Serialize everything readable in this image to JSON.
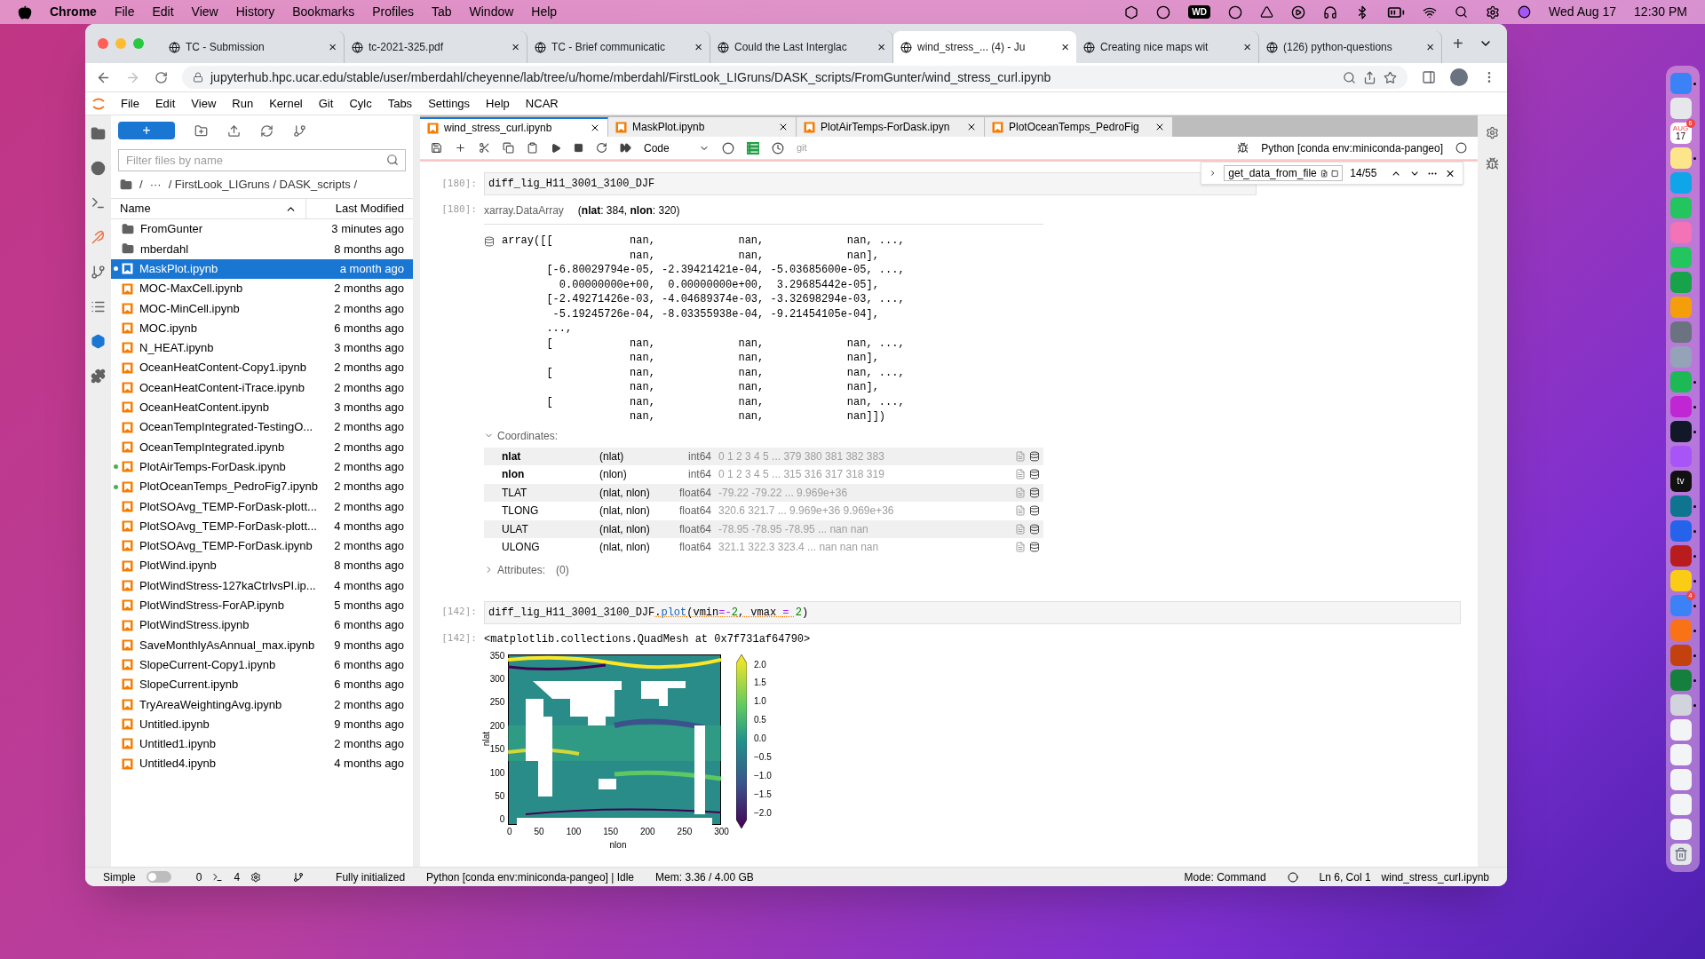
{
  "menubar": {
    "app": "Chrome",
    "items": [
      "File",
      "Edit",
      "View",
      "History",
      "Bookmarks",
      "Profiles",
      "Tab",
      "Window",
      "Help"
    ],
    "wd": "WD",
    "date": "Wed Aug 17",
    "time": "12:30 PM"
  },
  "browser": {
    "tabs": [
      {
        "title": "TC - Submission",
        "selected": false
      },
      {
        "title": "tc-2021-325.pdf",
        "selected": false
      },
      {
        "title": "TC - Brief communicatic",
        "selected": false
      },
      {
        "title": "Could the Last Interglac",
        "selected": false
      },
      {
        "title": "wind_stress_... (4) - Ju",
        "selected": true
      },
      {
        "title": "Creating nice maps wit",
        "selected": false
      },
      {
        "title": "(126) python-questions",
        "selected": false
      }
    ],
    "close": "×",
    "new_tab": "+",
    "url": "jupyterhub.hpc.ucar.edu/stable/user/mberdahl/cheyenne/lab/tree/u/home/mberdahl/FirstLook_LIGruns/DASK_scripts/FromGunter/wind_stress_curl.ipynb"
  },
  "jupyter_menu": [
    "File",
    "Edit",
    "View",
    "Run",
    "Kernel",
    "Git",
    "Cylc",
    "Tabs",
    "Settings",
    "Help",
    "NCAR"
  ],
  "file_browser": {
    "new_label": "+",
    "filter": {
      "placeholder": "Filter files by name"
    },
    "breadcrumb": [
      "/",
      "···",
      "/ FirstLook_LIGruns / DASK_scripts /"
    ],
    "columns": [
      "Name",
      "Last Modified"
    ],
    "rows": [
      {
        "name": "FromGunter",
        "modified": "3 minutes ago",
        "kind": "folder",
        "selected": false,
        "running": false
      },
      {
        "name": "mberdahl",
        "modified": "8 months ago",
        "kind": "folder",
        "selected": false,
        "running": false
      },
      {
        "name": "MaskPlot.ipynb",
        "modified": "a month ago",
        "kind": "notebook",
        "selected": true,
        "running": true
      },
      {
        "name": "MOC-MaxCell.ipynb",
        "modified": "2 months ago",
        "kind": "notebook",
        "selected": false,
        "running": false
      },
      {
        "name": "MOC-MinCell.ipynb",
        "modified": "2 months ago",
        "kind": "notebook",
        "selected": false,
        "running": false
      },
      {
        "name": "MOC.ipynb",
        "modified": "6 months ago",
        "kind": "notebook",
        "selected": false,
        "running": false
      },
      {
        "name": "N_HEAT.ipynb",
        "modified": "3 months ago",
        "kind": "notebook",
        "selected": false,
        "running": false
      },
      {
        "name": "OceanHeatContent-Copy1.ipynb",
        "modified": "2 months ago",
        "kind": "notebook",
        "selected": false,
        "running": false
      },
      {
        "name": "OceanHeatContent-iTrace.ipynb",
        "modified": "2 months ago",
        "kind": "notebook",
        "selected": false,
        "running": false
      },
      {
        "name": "OceanHeatContent.ipynb",
        "modified": "3 months ago",
        "kind": "notebook",
        "selected": false,
        "running": false
      },
      {
        "name": "OceanTempIntegrated-TestingO...",
        "modified": "2 months ago",
        "kind": "notebook",
        "selected": false,
        "running": false
      },
      {
        "name": "OceanTempIntegrated.ipynb",
        "modified": "2 months ago",
        "kind": "notebook",
        "selected": false,
        "running": false
      },
      {
        "name": "PlotAirTemps-ForDask.ipynb",
        "modified": "2 months ago",
        "kind": "notebook",
        "selected": false,
        "running": true
      },
      {
        "name": "PlotOceanTemps_PedroFig7.ipynb",
        "modified": "2 months ago",
        "kind": "notebook",
        "selected": false,
        "running": true
      },
      {
        "name": "PlotSOAvg_TEMP-ForDask-plott...",
        "modified": "2 months ago",
        "kind": "notebook",
        "selected": false,
        "running": false
      },
      {
        "name": "PlotSOAvg_TEMP-ForDask-plott...",
        "modified": "4 months ago",
        "kind": "notebook",
        "selected": false,
        "running": false
      },
      {
        "name": "PlotSOAvg_TEMP-ForDask.ipynb",
        "modified": "2 months ago",
        "kind": "notebook",
        "selected": false,
        "running": false
      },
      {
        "name": "PlotWind.ipynb",
        "modified": "8 months ago",
        "kind": "notebook",
        "selected": false,
        "running": false
      },
      {
        "name": "PlotWindStress-127kaCtrlvsPI.ip...",
        "modified": "4 months ago",
        "kind": "notebook",
        "selected": false,
        "running": false
      },
      {
        "name": "PlotWindStress-ForAP.ipynb",
        "modified": "5 months ago",
        "kind": "notebook",
        "selected": false,
        "running": false
      },
      {
        "name": "PlotWindStress.ipynb",
        "modified": "6 months ago",
        "kind": "notebook",
        "selected": false,
        "running": false
      },
      {
        "name": "SaveMonthlyAsAnnual_max.ipynb",
        "modified": "9 months ago",
        "kind": "notebook",
        "selected": false,
        "running": false
      },
      {
        "name": "SlopeCurrent-Copy1.ipynb",
        "modified": "6 months ago",
        "kind": "notebook",
        "selected": false,
        "running": false
      },
      {
        "name": "SlopeCurrent.ipynb",
        "modified": "6 months ago",
        "kind": "notebook",
        "selected": false,
        "running": false
      },
      {
        "name": "TryAreaWeightingAvg.ipynb",
        "modified": "2 months ago",
        "kind": "notebook",
        "selected": false,
        "running": false
      },
      {
        "name": "Untitled.ipynb",
        "modified": "9 months ago",
        "kind": "notebook",
        "selected": false,
        "running": false
      },
      {
        "name": "Untitled1.ipynb",
        "modified": "2 months ago",
        "kind": "notebook",
        "selected": false,
        "running": false
      },
      {
        "name": "Untitled4.ipynb",
        "modified": "4 months ago",
        "kind": "notebook",
        "selected": false,
        "running": false
      }
    ]
  },
  "notebook": {
    "tabs": [
      {
        "title": "wind_stress_curl.ipynb",
        "selected": true
      },
      {
        "title": "MaskPlot.ipynb",
        "selected": false
      },
      {
        "title": "PlotAirTemps-ForDask.ipyn",
        "selected": false
      },
      {
        "title": "PlotOceanTemps_PedroFig",
        "selected": false
      }
    ],
    "cell_type": "Code",
    "git": "git",
    "kernel": "Python [conda env:miniconda-pangeo]",
    "find": {
      "value": "get_data_from_file",
      "count": "14/55"
    },
    "cell1": {
      "in_prompt": "[180]:",
      "code": "diff_lig_H11_3001_3100_DJF",
      "out_prompt": "[180]:",
      "type": "xarray.DataArray",
      "dims": "(**nlat**: 384, **nlon**: 320)",
      "array": [
        "array([[            nan,             nan,             nan, ...,",
        "                    nan,             nan,             nan],",
        "       [-6.80029794e-05, -2.39421421e-04, -5.03685600e-05, ...,",
        "         0.00000000e+00,  0.00000000e+00,  3.29685442e-05],",
        "       [-2.49271426e-03, -4.04689374e-03, -3.32698294e-03, ...,",
        "        -5.19245726e-04, -8.03355938e-04, -9.21454105e-04],",
        "       ...,",
        "       [            nan,             nan,             nan, ...,",
        "                    nan,             nan,             nan],",
        "       [            nan,             nan,             nan, ...,",
        "                    nan,             nan,             nan],",
        "       [            nan,             nan,             nan, ...,",
        "                    nan,             nan,             nan]])"
      ],
      "coords_label": "Coordinates:",
      "coords_expanded": true,
      "coords": [
        {
          "name": "nlat",
          "dims": "(nlat)",
          "dtype": "int64",
          "preview": "0 1 2 3 4 5 ... 379 380 381 382 383",
          "index": true
        },
        {
          "name": "nlon",
          "dims": "(nlon)",
          "dtype": "int64",
          "preview": "0 1 2 3 4 5 ... 315 316 317 318 319",
          "index": true
        },
        {
          "name": "TLAT",
          "dims": "(nlat, nlon)",
          "dtype": "float64",
          "preview": "-79.22 -79.22 ... 9.969e+36",
          "index": false
        },
        {
          "name": "TLONG",
          "dims": "(nlat, nlon)",
          "dtype": "float64",
          "preview": "320.6 321.7 ... 9.969e+36 9.969e+36",
          "index": false
        },
        {
          "name": "ULAT",
          "dims": "(nlat, nlon)",
          "dtype": "float64",
          "preview": "-78.95 -78.95 -78.95 ... nan nan",
          "index": false
        },
        {
          "name": "ULONG",
          "dims": "(nlat, nlon)",
          "dtype": "float64",
          "preview": "321.1 322.3 323.4 ... nan nan nan",
          "index": false
        }
      ],
      "attrs_label": "Attributes:",
      "attrs_count": "(0)",
      "attrs_expanded": false
    },
    "cell2": {
      "in_prompt": "[142]:",
      "tokens": [
        {
          "text": "diff_lig_H11_3001_3100_DJF",
          "kind": "name",
          "linted": false
        },
        {
          "text": ".",
          "kind": "name",
          "linted": true
        },
        {
          "text": "plot",
          "kind": "attr",
          "linted": true
        },
        {
          "text": "(vmin",
          "kind": "name",
          "linted": true
        },
        {
          "text": "=-",
          "kind": "op",
          "linted": true
        },
        {
          "text": "2",
          "kind": "num",
          "linted": true
        },
        {
          "text": ", vmax ",
          "kind": "name",
          "linted": true
        },
        {
          "text": "= ",
          "kind": "op",
          "linted": true
        },
        {
          "text": "2",
          "kind": "num",
          "linted": false
        },
        {
          "text": ")",
          "kind": "name",
          "linted": false
        }
      ],
      "out_prompt": "[142]:",
      "repr": "<matplotlib.collections.QuadMesh at 0x7f731af64790>",
      "figure": {
        "ylabel": "nlat",
        "xlabel": "nlon",
        "yticks": [
          "350",
          "300",
          "250",
          "200",
          "150",
          "100",
          "50",
          "0"
        ],
        "xticks": [
          "0",
          "50",
          "100",
          "150",
          "200",
          "250",
          "300"
        ],
        "cbar_ticks": [
          "2.0",
          "1.5",
          "1.0",
          "0.5",
          "0.0",
          "−0.5",
          "−1.0",
          "−1.5",
          "−2.0"
        ]
      }
    }
  },
  "status_bar": {
    "simple_label": "Simple",
    "simple_on": false,
    "terminals": "0",
    "kernels": "4",
    "init": "Fully initialized",
    "kernel": "Python [conda env:miniconda-pangeo] | Idle",
    "mem": "Mem: 3.36 / 4.00 GB",
    "mode": "Mode: Command",
    "cursor": "Ln 6, Col 1",
    "file": "wind_stress_curl.ipynb"
  },
  "dock": [
    {
      "running": true
    },
    {
      "running": false
    },
    {
      "running": false,
      "label": "17",
      "month": "AUG",
      "badge": "6"
    },
    {
      "running": true
    },
    {
      "running": false
    },
    {
      "running": false
    },
    {
      "running": false
    },
    {
      "running": false
    },
    {
      "running": false
    },
    {
      "running": false
    },
    {
      "running": false
    },
    {
      "running": false
    },
    {
      "running": true
    },
    {
      "running": true
    },
    {
      "running": true
    },
    {
      "running": false
    },
    {
      "running": false,
      "label": "tv"
    },
    {
      "running": true
    },
    {
      "running": true
    },
    {
      "running": true
    },
    {
      "running": true
    },
    {
      "running": true,
      "badge": "4"
    },
    {
      "running": true
    },
    {
      "running": true
    },
    {
      "running": true
    },
    {
      "running": true
    },
    {
      "running": false
    },
    {
      "running": false
    },
    {
      "running": false
    },
    {
      "running": false
    },
    {
      "running": false
    },
    {
      "running": false
    }
  ]
}
